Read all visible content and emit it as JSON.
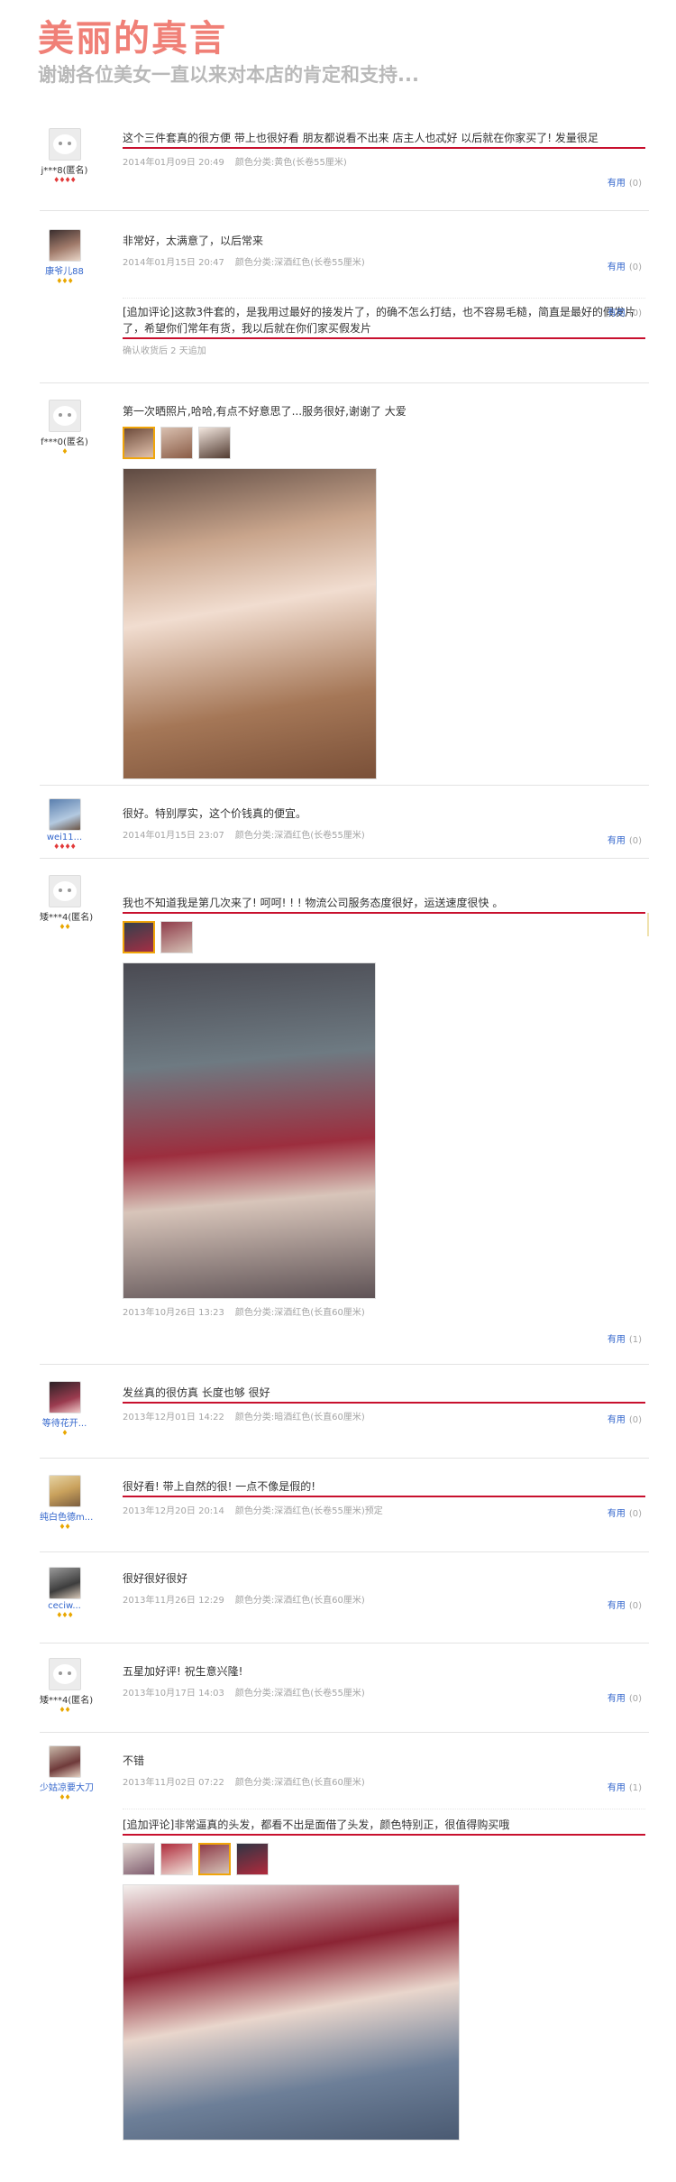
{
  "header": {
    "title": "美丽的真言",
    "subtitle": "谢谢各位美女一直以来对本店的肯定和支持..."
  },
  "useful_label": "有用",
  "reviews": [
    {
      "user": "j***8(匿名)",
      "rank": "♦♦♦♦",
      "text": "这个三件套真的很方便 带上也很好看 朋友都说看不出来 店主人也忒好 以后就在你家买了! 发量很足",
      "date": "2014年01月09日 20:49",
      "sku": "颜色分类:黄色(长卷55厘米)",
      "useful_count": "(0)"
    },
    {
      "user": "康爷儿88",
      "rank": "♦♦♦",
      "text": "非常好，太满意了，以后常来",
      "date": "2014年01月15日 20:47",
      "sku": "颜色分类:深酒红色(长卷55厘米)",
      "useful_count": "(0)",
      "followup": "[追加评论]这款3件套的，是我用过最好的接发片了，的确不怎么打结，也不容易毛糙，简直是最好的假发片了，希望你们常年有货，我以后就在你们家买假发片",
      "followup_meta": "确认收货后 2 天追加"
    },
    {
      "user": "f***0(匿名)",
      "rank": "♦",
      "text": "第一次晒照片,哈哈,有点不好意思了...服务很好,谢谢了 大爱"
    },
    {
      "user": "wei11...",
      "rank": "♦♦♦♦",
      "text": "很好。特别厚实，这个价钱真的便宜。",
      "date": "2014年01月15日 23:07",
      "sku": "颜色分类:深酒红色(长卷55厘米)",
      "useful_count": "(0)"
    },
    {
      "user": "矮***4(匿名)",
      "rank": "♦♦",
      "text": "我也不知道我是第几次来了! 呵呵! ! ! 物流公司服务态度很好，运送速度很快 。",
      "date": "2013年10月26日 13:23",
      "sku": "颜色分类:深酒红色(长直60厘米)",
      "useful_count": "(1)"
    },
    {
      "user": "等待花开...",
      "rank": "♦",
      "text": "发丝真的很仿真 长度也够 很好",
      "date": "2013年12月01日 14:22",
      "sku": "颜色分类:暗酒红色(长直60厘米)",
      "useful_count": "(0)"
    },
    {
      "user": "纯白色德m...",
      "rank": "♦♦",
      "text": "很好看! 带上自然的很! 一点不像是假的!",
      "date": "2013年12月20日 20:14",
      "sku": "颜色分类:深酒红色(长卷55厘米)预定",
      "useful_count": "(0)"
    },
    {
      "user": "ceciw...",
      "rank": "♦♦♦",
      "text": "很好很好很好",
      "date": "2013年11月26日 12:29",
      "sku": "颜色分类:深酒红色(长直60厘米)",
      "useful_count": "(0)"
    },
    {
      "user": "矮***4(匿名)",
      "rank": "♦♦",
      "text": "五星加好评! 祝生意兴隆!",
      "date": "2013年10月17日 14:03",
      "sku": "颜色分类:深酒红色(长卷55厘米)",
      "useful_count": "(0)"
    },
    {
      "user": "少姑凉要大刀",
      "rank": "♦♦",
      "text": "不错",
      "date": "2013年11月02日 07:22",
      "sku": "颜色分类:深酒红色(长直60厘米)",
      "useful_count": "(1)",
      "followup": "[追加评论]非常逼真的头发，都看不出是面借了头发，颜色特别正，很值得购买哦"
    }
  ]
}
